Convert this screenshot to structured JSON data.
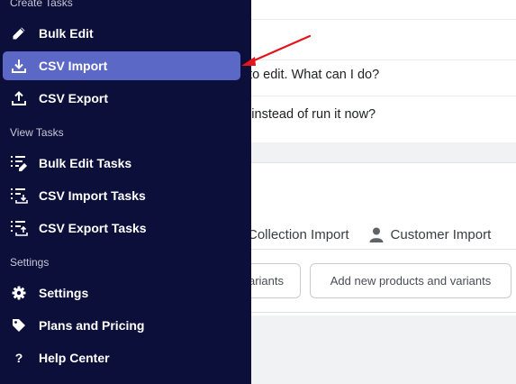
{
  "sidebar": {
    "sections": [
      {
        "title": "Create Tasks"
      },
      {
        "title": "View Tasks"
      },
      {
        "title": "Settings"
      }
    ],
    "items": [
      {
        "label": "Bulk Edit",
        "icon": "pencil-icon"
      },
      {
        "label": "CSV Import",
        "icon": "download-icon",
        "active": true
      },
      {
        "label": "CSV Export",
        "icon": "upload-icon"
      },
      {
        "label": "Bulk Edit Tasks",
        "icon": "list-pencil-icon"
      },
      {
        "label": "CSV Import Tasks",
        "icon": "list-download-icon"
      },
      {
        "label": "CSV Export Tasks",
        "icon": "list-upload-icon"
      },
      {
        "label": "Settings",
        "icon": "gear-icon"
      },
      {
        "label": "Plans and Pricing",
        "icon": "tag-icon"
      },
      {
        "label": "Help Center",
        "icon": "question-icon"
      }
    ],
    "active_color": "#5c68c6",
    "bg_color": "#0c0f3a"
  },
  "main": {
    "faq": [
      {
        "text": "t to edit. What can I do?"
      },
      {
        "text": "k instead of run it now?"
      }
    ],
    "tabs": [
      {
        "label": "Collection Import"
      },
      {
        "label": "Customer Import",
        "icon": "person-icon"
      }
    ],
    "buttons": [
      {
        "label": "variants"
      },
      {
        "label": "Add new products and variants"
      }
    ]
  },
  "annotation": {
    "color": "#e3141b"
  }
}
